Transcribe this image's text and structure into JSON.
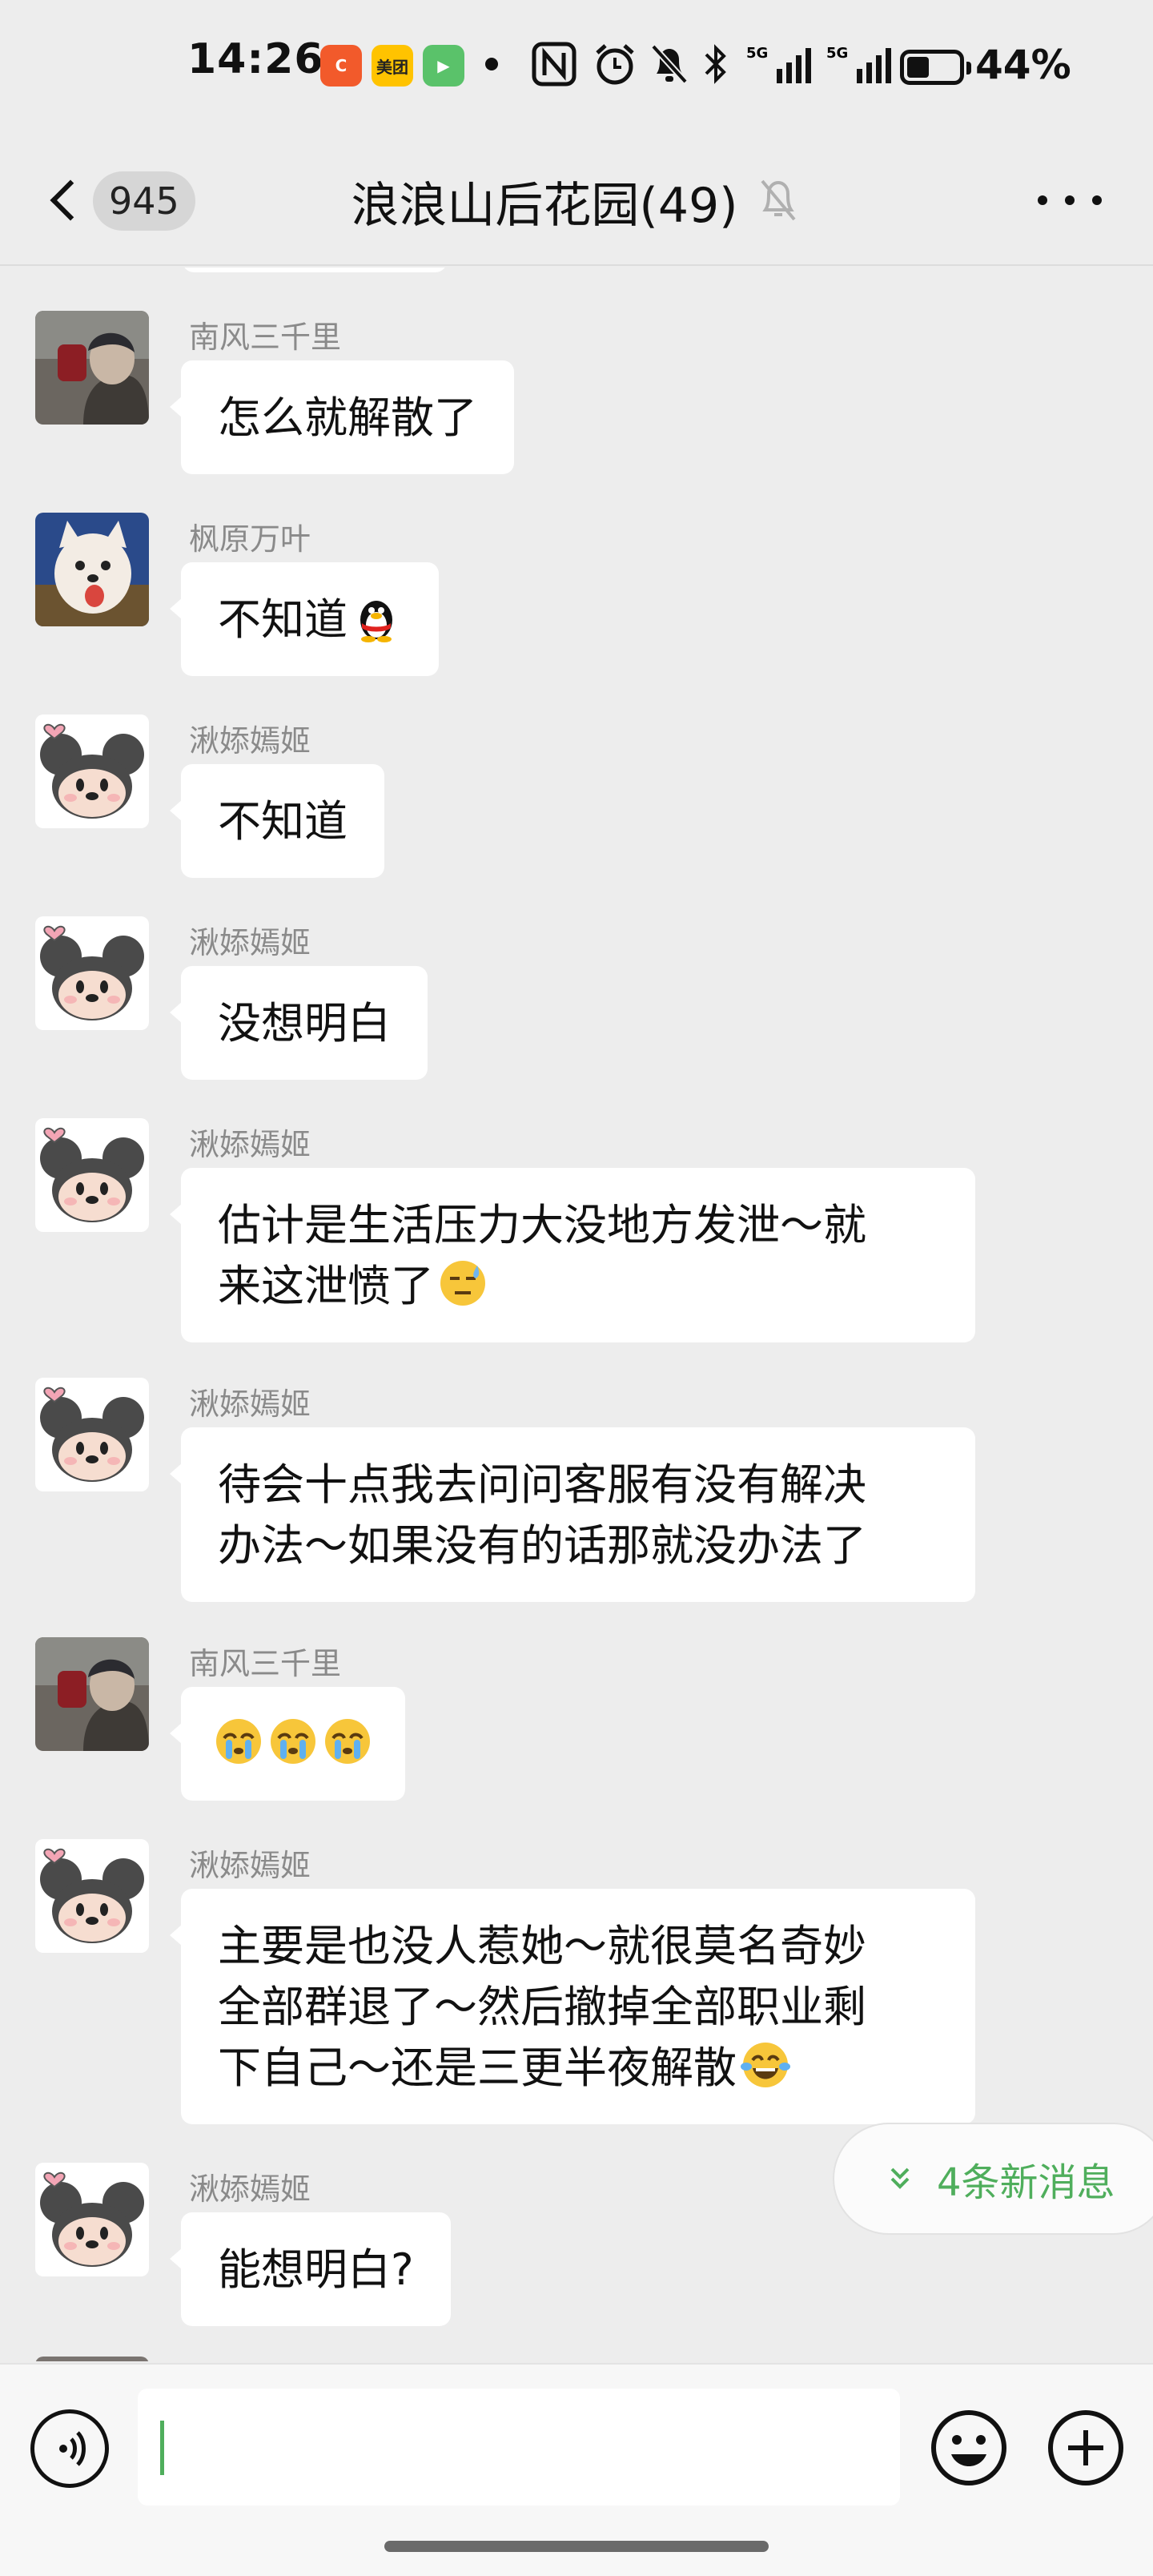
{
  "status_bar": {
    "time": "14:26",
    "app_badges": [
      {
        "label": "C",
        "color": "#f25a2b",
        "icon": "app-c-icon"
      },
      {
        "label": "美团",
        "color": "#ffc300",
        "icon": "meituan-icon"
      },
      {
        "label": "▶",
        "color": "#5ac26a",
        "icon": "video-app-icon"
      }
    ],
    "network_1": "5G",
    "network_2": "5G",
    "battery_percent": "44%",
    "battery_level": 0.44
  },
  "header": {
    "back_count": "945",
    "title": "浪浪山后花园(49)",
    "muted": true
  },
  "messages": [
    {
      "sender": "南风三千里",
      "avatar": "nanfeng",
      "text": "怎么就解散了",
      "emoji": []
    },
    {
      "sender": "枫原万叶",
      "avatar": "dog",
      "text": "不知道",
      "emoji": [
        "penguin-emoji"
      ]
    },
    {
      "sender": "湫婖嫣姬",
      "avatar": "mouse",
      "text": "不知道",
      "emoji": []
    },
    {
      "sender": "湫婖嫣姬",
      "avatar": "mouse",
      "text": "没想明白",
      "emoji": []
    },
    {
      "sender": "湫婖嫣姬",
      "avatar": "mouse",
      "lines": [
        "估计是生活压力大没地方发泄～就",
        "来这泄愤了"
      ],
      "emoji": [
        "sweat-emoji"
      ]
    },
    {
      "sender": "湫婖嫣姬",
      "avatar": "mouse",
      "lines": [
        "待会十点我去问问客服有没有解决",
        "办法～如果没有的话那就没办法了"
      ],
      "emoji": []
    },
    {
      "sender": "南风三千里",
      "avatar": "nanfeng",
      "text": "",
      "emoji": [
        "crying-emoji",
        "crying-emoji",
        "crying-emoji"
      ]
    },
    {
      "sender": "湫婖嫣姬",
      "avatar": "mouse",
      "lines": [
        "主要是也没人惹她～就很莫名奇妙",
        "全部群退了～然后撤掉全部职业剩",
        "下自己～还是三更半夜解散"
      ],
      "emoji": [
        "tears-of-joy-emoji"
      ]
    },
    {
      "sender": "湫婖嫣姬",
      "avatar": "mouse",
      "text": "能想明白?",
      "emoji": []
    }
  ],
  "new_messages": {
    "label": "4条新消息"
  },
  "input": {
    "value": ""
  },
  "colors": {
    "accent": "#4fae5c",
    "bubble": "#ffffff",
    "background": "#ededed"
  }
}
